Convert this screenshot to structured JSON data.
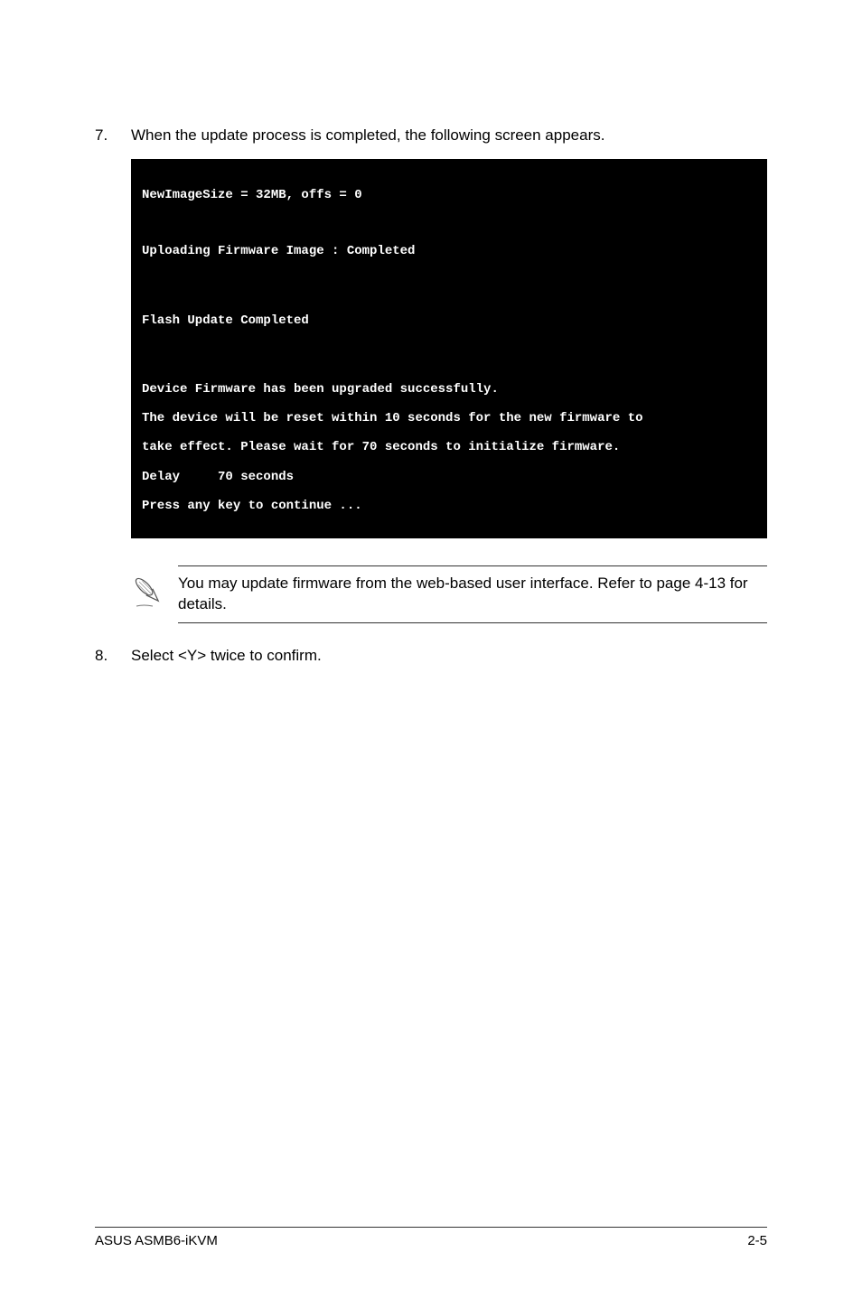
{
  "step7": {
    "number": "7.",
    "text": "When the update process is completed, the following screen appears."
  },
  "terminal": {
    "line1": "NewImageSize = 32MB, offs = 0",
    "line2": "Uploading Firmware Image : Completed",
    "line3": "Flash Update Completed",
    "line4": "Device Firmware has been upgraded successfully.",
    "line5": "The device will be reset within 10 seconds for the new firmware to",
    "line6": "take effect. Please wait for 70 seconds to initialize firmware.",
    "line7": "Delay     70 seconds",
    "line8": "Press any key to continue ..."
  },
  "note": {
    "text": "You may update firmware from the web-based user interface. Refer to page 4-13 for details."
  },
  "step8": {
    "number": "8.",
    "text": "Select <Y> twice to confirm."
  },
  "footer": {
    "left": "ASUS ASMB6-iKVM",
    "right": "2-5"
  }
}
